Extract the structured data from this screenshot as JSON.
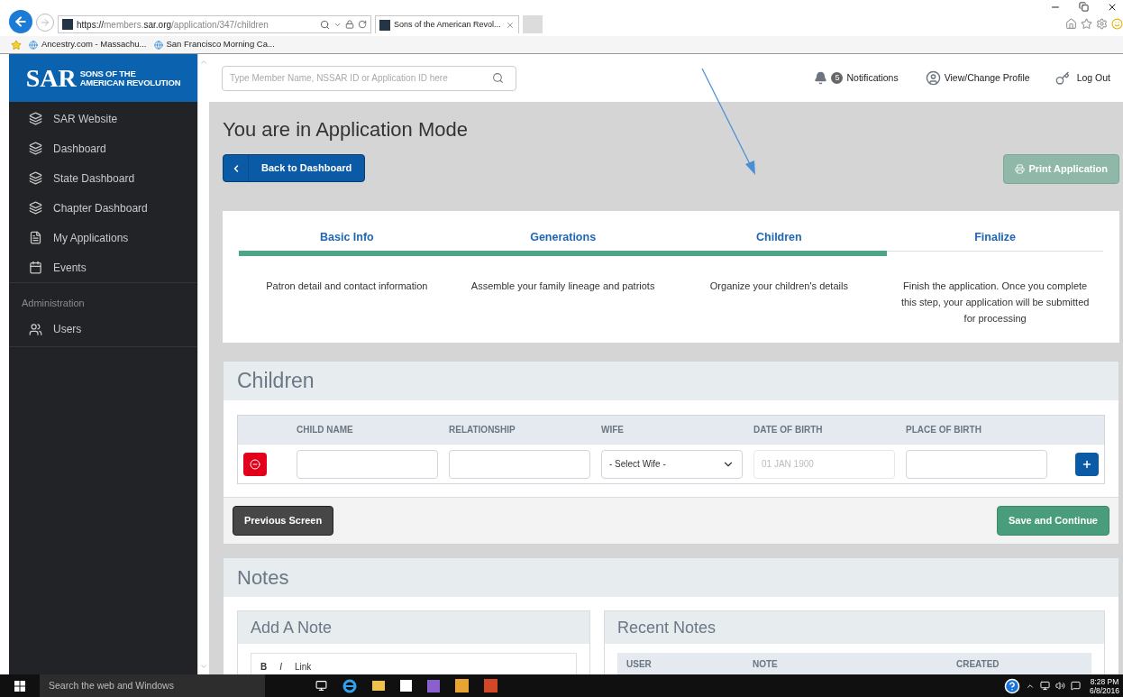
{
  "browser": {
    "url": [
      {
        "text": "https://",
        "strong": true
      },
      {
        "text": "members.",
        "strong": false
      },
      {
        "text": "sar.org",
        "strong": true
      },
      {
        "text": "/application/347/children",
        "strong": false
      }
    ],
    "tab_title": "Sons of the American Revol...",
    "favorites": [
      "Ancestry.com - Massachu...",
      "San Francisco Morning Ca..."
    ]
  },
  "logo": {
    "mark": "SAR",
    "line_1": "SONS OF THE",
    "line_2": "AMERICAN REVOLUTION"
  },
  "search": {
    "placeholder": "Type Member Name, NSSAR ID or Application ID here"
  },
  "header": {
    "notifications": {
      "count": "5",
      "label": "Notifications"
    },
    "profile": "View/Change Profile",
    "logout": "Log Out"
  },
  "sidebar": {
    "items": [
      {
        "label": "SAR Website",
        "kind": "layers"
      },
      {
        "label": "Dashboard",
        "kind": "layers"
      },
      {
        "label": "State Dashboard",
        "kind": "layers"
      },
      {
        "label": "Chapter Dashboard",
        "kind": "layers"
      },
      {
        "label": "My Applications",
        "kind": "document"
      },
      {
        "label": "Events",
        "kind": "calendar"
      }
    ],
    "sections": [
      {
        "title": "Administration",
        "items": [
          {
            "label": "Users",
            "kind": "users"
          }
        ]
      }
    ]
  },
  "page": {
    "title": "You are in Application Mode",
    "back_button": "Back to Dashboard",
    "print_button": {
      "label": "Print Application",
      "disabled": true
    }
  },
  "steps": [
    {
      "label": "Basic Info",
      "description": "Patron detail and contact information",
      "done": true
    },
    {
      "label": "Generations",
      "description": "Assemble your family lineage and patriots",
      "done": true
    },
    {
      "label": "Children",
      "description": "Organize your children's details",
      "done": true
    },
    {
      "label": "Finalize",
      "description": "Finish the application. Once you complete this step, your application will be submitted for processing",
      "done": false
    }
  ],
  "children": {
    "title": "Children",
    "columns": [
      "CHILD NAME",
      "RELATIONSHIP",
      "WIFE",
      "DATE OF BIRTH",
      "PLACE OF BIRTH"
    ],
    "rows": [
      {
        "fields": [
          {
            "kind": "text"
          },
          {
            "kind": "text"
          },
          {
            "kind": "select",
            "value": "- Select Wife -"
          },
          {
            "kind": "date",
            "placeholder": "01 JAN 1900"
          },
          {
            "kind": "text"
          }
        ]
      }
    ],
    "previous_button": "Previous Screen",
    "save_button": "Save and Continue"
  },
  "notes": {
    "title": "Notes",
    "add_note": {
      "title": "Add A Note",
      "toolbar": [
        {
          "label": "B",
          "kind": "bold"
        },
        {
          "label": "I",
          "kind": "italic"
        },
        {
          "label": "Link",
          "kind": "link"
        }
      ]
    },
    "recent": {
      "title": "Recent Notes",
      "columns": [
        "USER",
        "NOTE",
        "CREATED"
      ]
    }
  },
  "taskbar": {
    "search": "Search the web and Windows",
    "time": "8:28 PM",
    "date": "6/8/2016"
  }
}
